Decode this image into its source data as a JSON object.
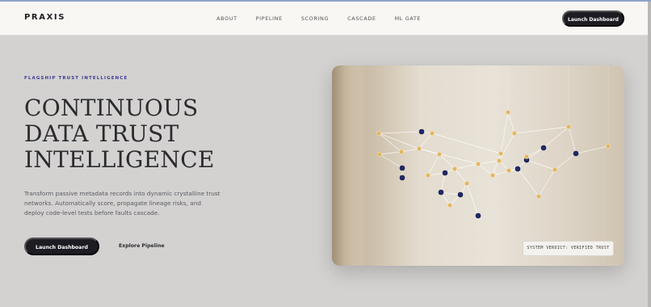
{
  "brand": "PRAXIS",
  "nav": {
    "links": [
      "ABOUT",
      "PIPELINE",
      "SCORING",
      "CASCADE",
      "ML GATE"
    ],
    "cta": "Launch Dashboard"
  },
  "hero": {
    "eyebrow": "FLAGSHIP TRUST INTELLIGENCE",
    "headline": [
      "CONTINUOUS",
      "DATA TRUST",
      "INTELLIGENCE"
    ],
    "subtext": "Transform passive metadata records into dynamic crystalline trust networks. Automatically score, propagate lineage risks, and deploy code-level tests before faults cascade.",
    "primary_cta": "Launch Dashboard",
    "secondary_cta": "Explore Pipeline"
  },
  "image_card": {
    "verdict": "SYSTEM VERDICT: VERIFIED TRUST"
  },
  "colors": {
    "accent": "#3d3a91",
    "dark_button": "#1d1c22",
    "page_bg": "#d3d2d1",
    "nav_bg": "#f8f7f4",
    "node_gold": "#e2b560",
    "node_navy": "#1f2a6b"
  }
}
